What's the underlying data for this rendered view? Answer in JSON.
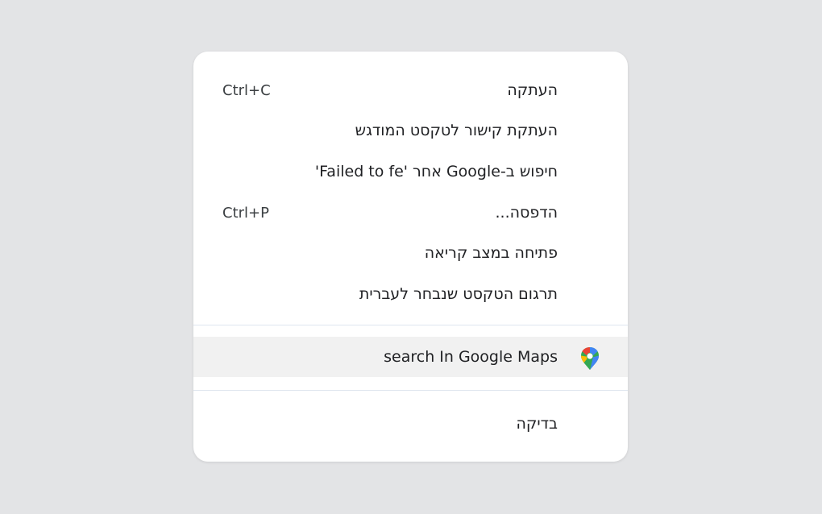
{
  "menu": {
    "items": [
      {
        "label": "העתקה",
        "shortcut": "Ctrl+C"
      },
      {
        "label": "העתקת קישור לטקסט המודגש",
        "shortcut": ""
      },
      {
        "label": "חיפוש ב-Google אחר 'Failed to fe'",
        "shortcut": ""
      },
      {
        "label": "הדפסה...",
        "shortcut": "Ctrl+P"
      },
      {
        "label": "פתיחה במצב קריאה",
        "shortcut": ""
      },
      {
        "label": "תרגום הטקסט שנבחר לעברית",
        "shortcut": ""
      }
    ],
    "extension_item": {
      "label": "search In Google Maps",
      "icon": "google-maps-icon"
    },
    "inspect_item": {
      "label": "בדיקה"
    }
  },
  "colors": {
    "background": "#e3e4e6",
    "menu_background": "#ffffff",
    "highlight": "#f1f1f1",
    "separator": "#dfe6ef",
    "text": "#202124"
  }
}
